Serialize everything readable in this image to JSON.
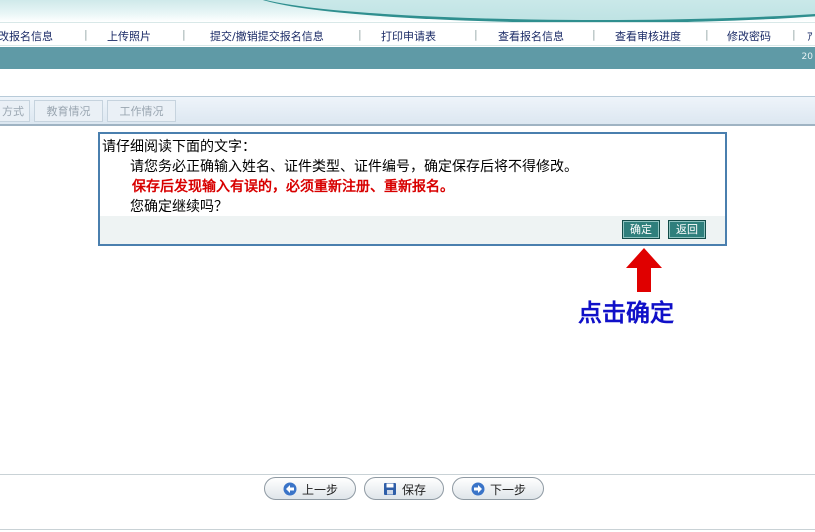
{
  "menu": {
    "items": [
      {
        "label": "改报名信息"
      },
      {
        "label": "上传照片"
      },
      {
        "label": "提交/撤销提交报名信息"
      },
      {
        "label": "打印申请表"
      },
      {
        "label": "查看报名信息"
      },
      {
        "label": "查看审核进度"
      },
      {
        "label": "修改密码"
      },
      {
        "label": "ｱ"
      }
    ],
    "separator": "|"
  },
  "status_bar": {
    "date_fragment": "20"
  },
  "tabs": [
    {
      "label": "方式"
    },
    {
      "label": "教育情况"
    },
    {
      "label": "工作情况"
    }
  ],
  "dialog": {
    "heading": "请仔细阅读下面的文字：",
    "message": "请您务必正确输入姓名、证件类型、证件编号，确定保存后将不得修改。",
    "warning": "保存后发现输入有误的，必须重新注册、重新报名。",
    "question": "您确定继续吗？",
    "confirm_label": "确定",
    "back_label": "返回"
  },
  "annotation": {
    "text": "点击确定",
    "color": "#1010c8",
    "arrow_color": "#e00000"
  },
  "nav": {
    "prev_label": "上一步",
    "save_label": "保存",
    "next_label": "下一步"
  },
  "colors": {
    "accent": "#5f9aa6",
    "dialog_border": "#4a7fae",
    "button": "#2f7f7c",
    "warning": "#d80000"
  }
}
